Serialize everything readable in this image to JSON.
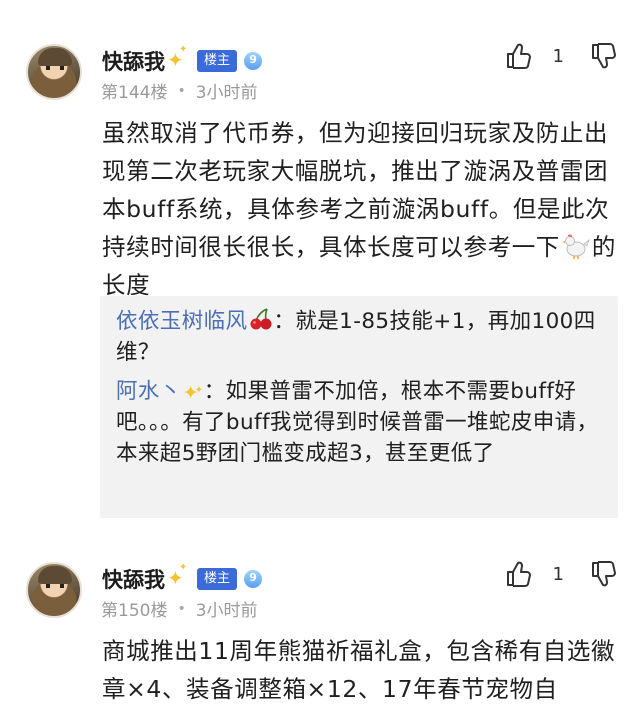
{
  "posts": [
    {
      "username": "快舔我",
      "owner_badge": "楼主",
      "level": "9",
      "floor": "第144楼",
      "time": "3小时前",
      "like_count": "1",
      "content_before_emoji": "虽然取消了代币券，但为迎接回归玩家及防止出现第二次老玩家大幅脱坑，推出了漩涡及普雷团本buff系统，具体参考之前漩涡buff。但是此次持续时间很长很长，具体长度可以参考一下",
      "content_after_emoji": "的长度",
      "content_emoji": "chicken-emoji",
      "replies": [
        {
          "name": "依依玉树临风",
          "name_emoji": "cherry-emoji",
          "separator": "：",
          "text": "就是1-85技能+1，再加100四维？"
        },
        {
          "name": "阿水丶",
          "name_emoji": "sparkle-emoji",
          "separator": "：",
          "text": "如果普雷不加倍，根本不需要buff好吧。。。有了buff我觉得到时候普雷一堆蛇皮申请，本来超5野团门槛变成超3，甚至更低了"
        }
      ]
    },
    {
      "username": "快舔我",
      "owner_badge": "楼主",
      "level": "9",
      "floor": "第150楼",
      "time": "3小时前",
      "like_count": "1",
      "content": "商城推出11周年熊猫祈福礼盒，包含稀有自选徽章×4、装备调整箱×12、17年春节宠物自"
    }
  ],
  "meta_separator": "•",
  "icons": {
    "like": "thumbs-up-icon",
    "dislike": "thumbs-down-icon",
    "badge": "level-badge-icon"
  },
  "colors": {
    "owner_badge": "#3a6bd8",
    "reply_name": "#4a6fb5",
    "meta": "#9a9a9a",
    "reply_bg": "#f2f2f2"
  }
}
